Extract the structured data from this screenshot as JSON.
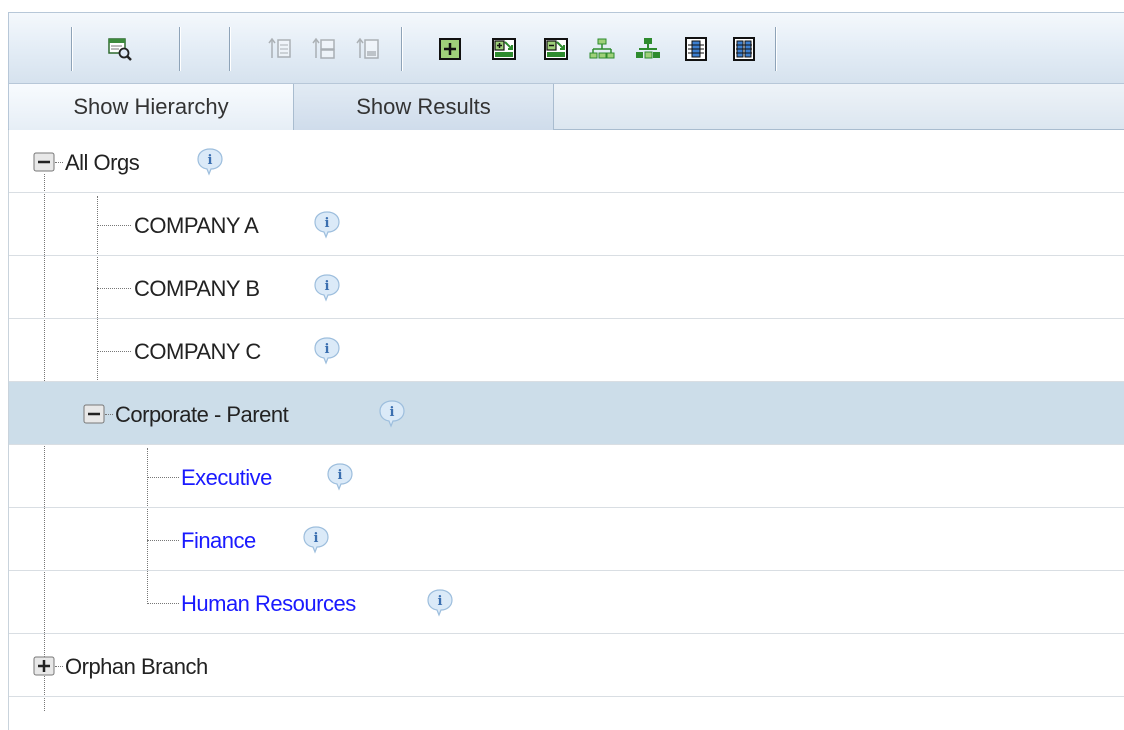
{
  "toolbar": {
    "buttons": [
      {
        "icon": "find-in-list-icon",
        "enabled": true
      },
      {
        "icon": "move-to-top-icon",
        "enabled": false
      },
      {
        "icon": "move-up-icon",
        "enabled": false
      },
      {
        "icon": "move-to-bottom-icon",
        "enabled": false
      },
      {
        "icon": "expand-icon",
        "enabled": true
      },
      {
        "icon": "expand-all-icon",
        "enabled": true
      },
      {
        "icon": "collapse-all-icon",
        "enabled": true
      },
      {
        "icon": "show-tree-icon",
        "enabled": true
      },
      {
        "icon": "show-tree-green-icon",
        "enabled": true
      },
      {
        "icon": "single-column-icon",
        "enabled": true
      },
      {
        "icon": "multi-column-icon",
        "enabled": true
      }
    ]
  },
  "tabs": {
    "hierarchy": "Show Hierarchy",
    "results": "Show Results"
  },
  "tree": {
    "root": {
      "label": "All Orgs",
      "expanded": true
    },
    "companies": [
      {
        "label": "COMPANY A"
      },
      {
        "label": "COMPANY B"
      },
      {
        "label": "COMPANY C"
      }
    ],
    "corporate": {
      "label": "Corporate - Parent",
      "expanded": true,
      "selected": true
    },
    "departments": [
      {
        "label": "Executive"
      },
      {
        "label": "Finance"
      },
      {
        "label": "Human Resources"
      }
    ],
    "orphan": {
      "label": "Orphan Branch",
      "expanded": false
    }
  },
  "colors": {
    "selected_row": "#ccdde9",
    "department_text": "#1a1aff",
    "toolbar_icon_green": "#2e8b2e"
  }
}
